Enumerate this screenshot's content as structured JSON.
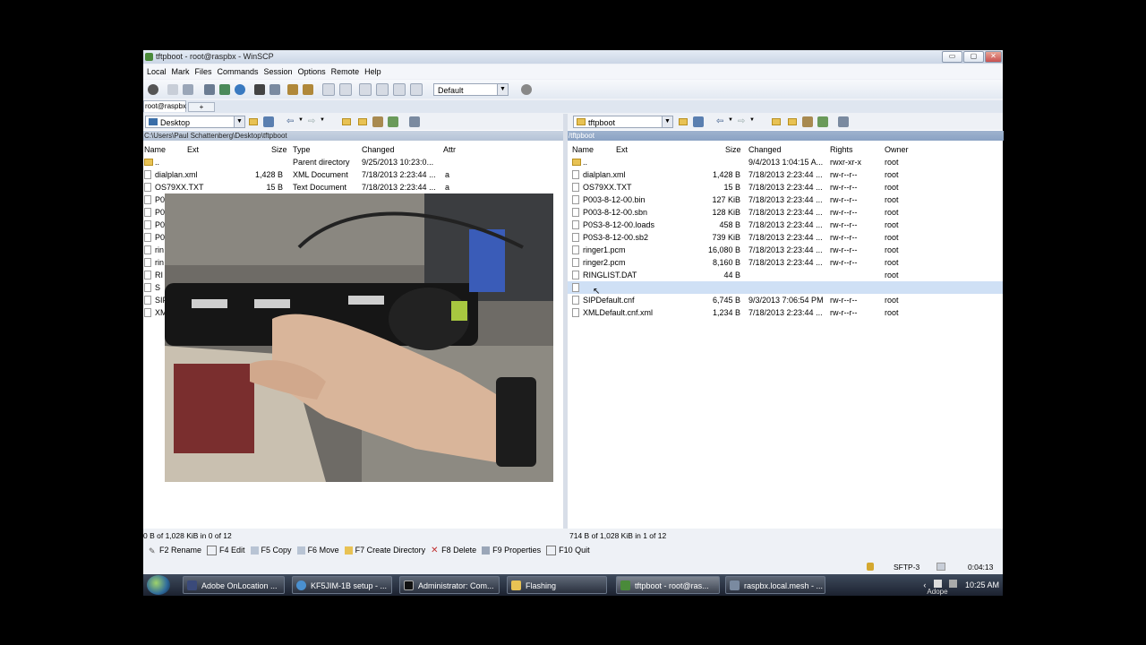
{
  "window": {
    "title": "tftpboot - root@raspbx - WinSCP",
    "controls": {
      "minimize": "▭",
      "maximize": "▢",
      "close": "✕"
    }
  },
  "menu": [
    "Local",
    "Mark",
    "Files",
    "Commands",
    "Session",
    "Options",
    "Remote",
    "Help"
  ],
  "toolbar": {
    "transfer_setting": "Default"
  },
  "session_tabs": {
    "active": "root@raspbx",
    "new_tab": "+"
  },
  "local": {
    "location": "Desktop",
    "path": "C:\\Users\\Paul Schattenberg\\Desktop\\tftpboot",
    "columns": [
      "Name",
      "Ext",
      "Size",
      "Type",
      "Changed",
      "Attr"
    ],
    "rows": [
      {
        "name": "..",
        "size": "",
        "type": "Parent directory",
        "changed": "9/25/2013 10:23:0...",
        "attr": "",
        "is_folder": true
      },
      {
        "name": "dialplan.xml",
        "size": "1,428 B",
        "type": "XML Document",
        "changed": "7/18/2013 2:23:44 ...",
        "attr": "a"
      },
      {
        "name": "OS79XX.TXT",
        "size": "15 B",
        "type": "Text Document",
        "changed": "7/18/2013 2:23:44 ...",
        "attr": "a"
      },
      {
        "name": "P0",
        "size": "",
        "type": "",
        "changed": "",
        "attr": ""
      },
      {
        "name": "P0",
        "size": "",
        "type": "",
        "changed": "",
        "attr": ""
      },
      {
        "name": "P0",
        "size": "",
        "type": "",
        "changed": "",
        "attr": ""
      },
      {
        "name": "P0",
        "size": "",
        "type": "",
        "changed": "",
        "attr": ""
      },
      {
        "name": "rin",
        "size": "",
        "type": "",
        "changed": "",
        "attr": ""
      },
      {
        "name": "rin",
        "size": "",
        "type": "",
        "changed": "",
        "attr": ""
      },
      {
        "name": "RI",
        "size": "",
        "type": "",
        "changed": "",
        "attr": ""
      },
      {
        "name": "S",
        "size": "",
        "type": "",
        "changed": "",
        "attr": ""
      },
      {
        "name": "SIP",
        "size": "",
        "type": "",
        "changed": "",
        "attr": ""
      },
      {
        "name": "XM",
        "size": "",
        "type": "",
        "changed": "",
        "attr": ""
      }
    ],
    "status": "0 B of 1,028 KiB in 0 of 12"
  },
  "remote": {
    "location": "tftpboot",
    "path": "/tftpboot",
    "columns": [
      "Name",
      "Ext",
      "Size",
      "Changed",
      "Rights",
      "Owner"
    ],
    "rows": [
      {
        "name": "..",
        "size": "",
        "changed": "9/4/2013 1:04:15 A...",
        "rights": "rwxr-xr-x",
        "owner": "root",
        "is_folder": true
      },
      {
        "name": "dialplan.xml",
        "size": "1,428 B",
        "changed": "7/18/2013 2:23:44 ...",
        "rights": "rw-r--r--",
        "owner": "root"
      },
      {
        "name": "OS79XX.TXT",
        "size": "15 B",
        "changed": "7/18/2013 2:23:44 ...",
        "rights": "rw-r--r--",
        "owner": "root"
      },
      {
        "name": "P003-8-12-00.bin",
        "size": "127 KiB",
        "changed": "7/18/2013 2:23:44 ...",
        "rights": "rw-r--r--",
        "owner": "root"
      },
      {
        "name": "P003-8-12-00.sbn",
        "size": "128 KiB",
        "changed": "7/18/2013 2:23:44 ...",
        "rights": "rw-r--r--",
        "owner": "root"
      },
      {
        "name": "P0S3-8-12-00.loads",
        "size": "458 B",
        "changed": "7/18/2013 2:23:44 ...",
        "rights": "rw-r--r--",
        "owner": "root"
      },
      {
        "name": "P0S3-8-12-00.sb2",
        "size": "739 KiB",
        "changed": "7/18/2013 2:23:44 ...",
        "rights": "rw-r--r--",
        "owner": "root"
      },
      {
        "name": "ringer1.pcm",
        "size": "16,080 B",
        "changed": "7/18/2013 2:23:44 ...",
        "rights": "rw-r--r--",
        "owner": "root"
      },
      {
        "name": "ringer2.pcm",
        "size": "8,160 B",
        "changed": "7/18/2013 2:23:44 ...",
        "rights": "rw-r--r--",
        "owner": "root"
      },
      {
        "name": "RINGLIST.DAT",
        "size": "44 B",
        "changed": "",
        "rights": "",
        "owner": "root"
      },
      {
        "name": "",
        "size": "",
        "changed": "",
        "rights": "",
        "owner": "",
        "selected": true
      },
      {
        "name": "SIPDefault.cnf",
        "size": "6,745 B",
        "changed": "9/3/2013 7:06:54 PM",
        "rights": "rw-r--r--",
        "owner": "root"
      },
      {
        "name": "XMLDefault.cnf.xml",
        "size": "1,234 B",
        "changed": "7/18/2013 2:23:44 ...",
        "rights": "rw-r--r--",
        "owner": "root"
      }
    ],
    "status": "714 B of 1,028 KiB in 1 of 12"
  },
  "commands": [
    "F2 Rename",
    "F4 Edit",
    "F5 Copy",
    "F6 Move",
    "F7 Create Directory",
    "F8 Delete",
    "F9 Properties",
    "F10 Quit"
  ],
  "bottom_status": {
    "protocol": "SFTP-3",
    "elapsed": "0:04:13"
  },
  "taskbar": {
    "buttons": [
      "Adobe OnLocation ...",
      "KF5JIM-1B setup - ...",
      "Administrator: Com...",
      "Flashing",
      "tftpboot - root@ras...",
      "raspbx.local.mesh - ..."
    ],
    "clock": "10:25 AM",
    "tray_label": "Adope"
  },
  "colors": {
    "accent": "#2e6a9c",
    "selection": "#cfe0f5",
    "path_strip": "#c0cde0"
  }
}
